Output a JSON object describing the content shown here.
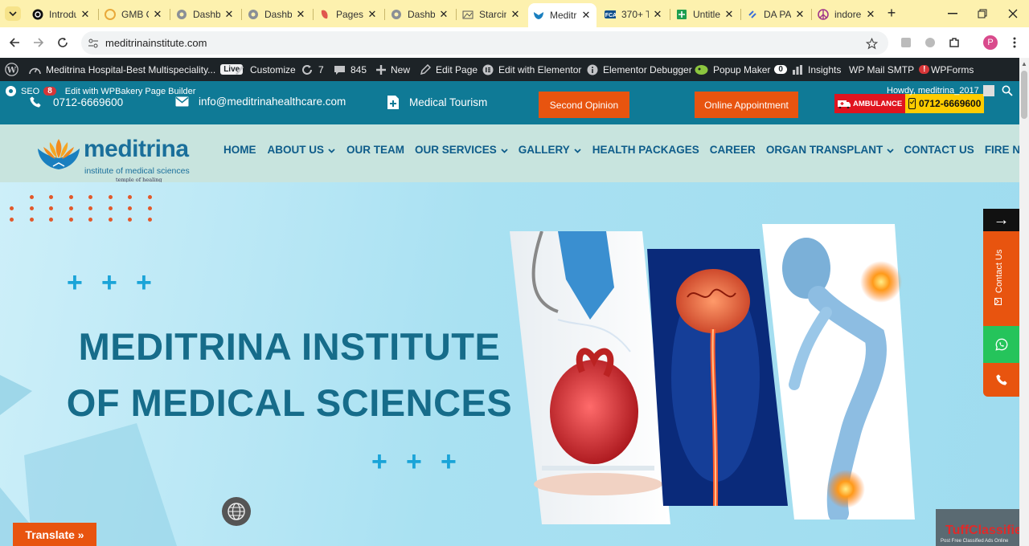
{
  "browser": {
    "tabs": [
      {
        "title": "Introdu",
        "icon": "threads-icon"
      },
      {
        "title": "GMB C",
        "icon": "gmb-icon"
      },
      {
        "title": "Dashbo",
        "icon": "dashboard-icon"
      },
      {
        "title": "Dashbo",
        "icon": "dashboard-icon"
      },
      {
        "title": "Pages",
        "icon": "pages-icon"
      },
      {
        "title": "Dashbo",
        "icon": "dashboard-icon"
      },
      {
        "title": "Starcin",
        "icon": "starcin-icon"
      },
      {
        "title": "Meditr",
        "icon": "meditrina-icon"
      },
      {
        "title": "370+ T",
        "icon": "fca-icon"
      },
      {
        "title": "Untitle",
        "icon": "sheets-icon"
      },
      {
        "title": "DA PA",
        "icon": "link-icon"
      },
      {
        "title": "indore",
        "icon": "peace-icon"
      }
    ],
    "active_tab": 7,
    "url": "meditrinainstitute.com",
    "profile_initial": "P"
  },
  "wp_admin": {
    "site_name": "Meditrina Hospital-Best Multispeciality...",
    "live_label": "Live",
    "customize": "Customize",
    "updates_count": "7",
    "comments_count": "845",
    "new_label": "New",
    "edit_page": "Edit Page",
    "edit_elementor": "Edit with Elementor",
    "elementor_debugger": "Elementor Debugger",
    "popup_maker": "Popup Maker",
    "popup_count": "0",
    "insights": "Insights",
    "wp_mail": "WP Mail SMTP",
    "wp_mail_alert": "!",
    "wpforms": "WPForms",
    "seo_label": "SEO",
    "seo_count": "8",
    "wpbakery": "Edit with WPBakery Page Builder",
    "howdy": "Howdy, meditrina_2017"
  },
  "topbar": {
    "phone": "0712-6669600",
    "email": "info@meditrinahealthcare.com",
    "tourism": "Medical Tourism",
    "second_opinion": "Second Opinion",
    "online_appointment": "Online Appointment",
    "ambulance_label": "AMBULANCE",
    "ambulance_phone": "0712-6669600"
  },
  "logo": {
    "word": "meditrina",
    "sub": "institute of medical sciences",
    "tag": "temple of healing"
  },
  "menu": [
    {
      "label": "HOME",
      "dropdown": false
    },
    {
      "label": "ABOUT US",
      "dropdown": true
    },
    {
      "label": "OUR TEAM",
      "dropdown": false
    },
    {
      "label": "OUR SERVICES",
      "dropdown": true
    },
    {
      "label": "GALLERY",
      "dropdown": true
    },
    {
      "label": "HEALTH PACKAGES",
      "dropdown": false
    },
    {
      "label": "CAREER",
      "dropdown": false
    },
    {
      "label": "ORGAN TRANSPLANT",
      "dropdown": true
    },
    {
      "label": "CONTACT US",
      "dropdown": false
    },
    {
      "label": "FIRE NOC",
      "dropdown": false
    }
  ],
  "hero": {
    "title_line1": "MEDITRINA INSTITUTE",
    "title_line2": "OF MEDICAL SCIENCES"
  },
  "side": {
    "arrow": "→",
    "contact_us": "Contact Us"
  },
  "translate_label": "Translate »",
  "tuff": {
    "brand_a": "Tuff",
    "brand_b": "Classified",
    "tagline": "Post Free Classified Ads Online"
  },
  "colors": {
    "teal": "#0f7a96",
    "orange": "#e8540f",
    "nav_bg": "#c8e4de",
    "brand_blue": "#1a6f9b"
  }
}
